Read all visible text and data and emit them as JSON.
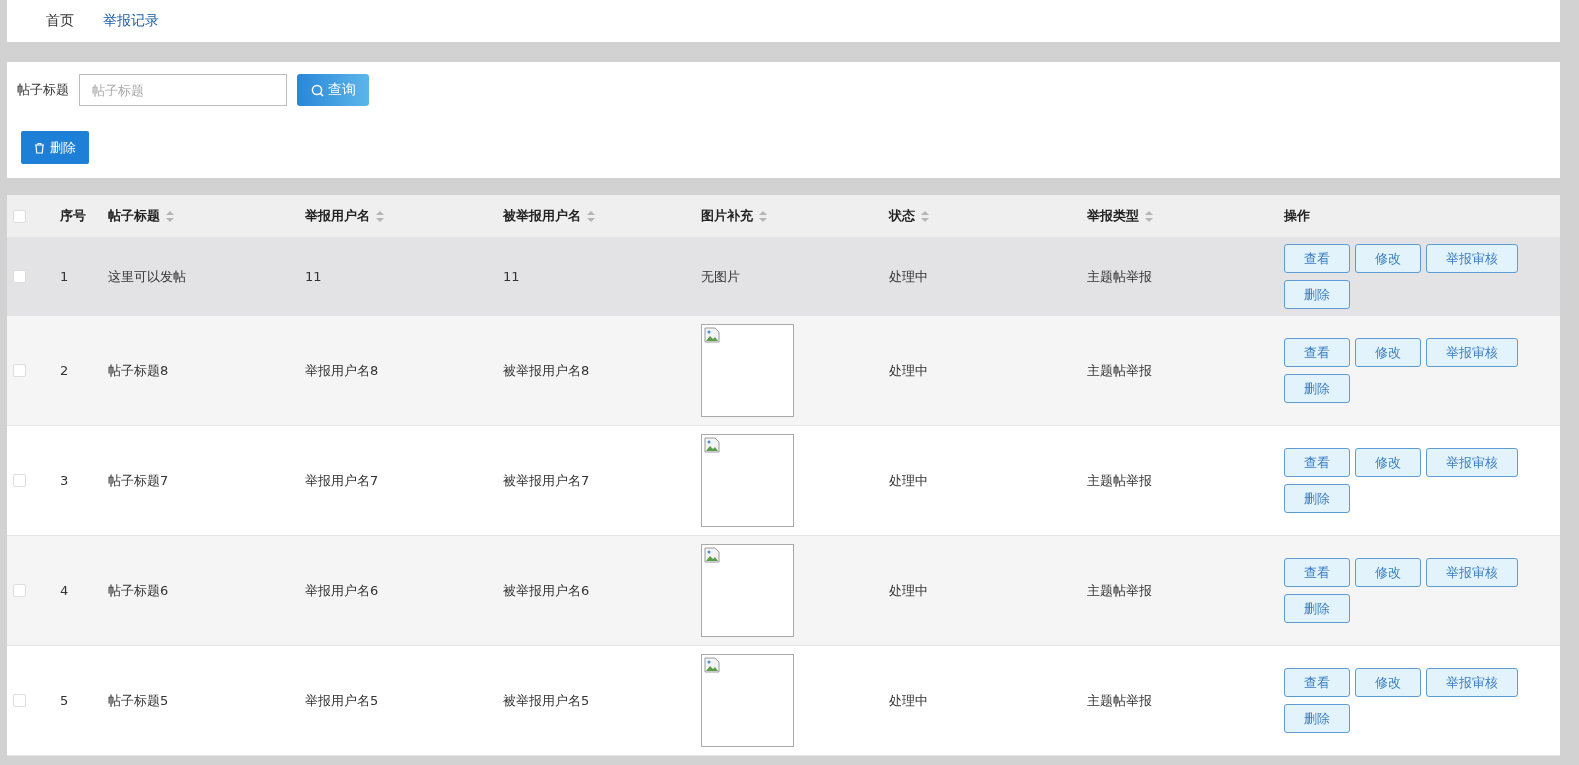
{
  "nav": [
    {
      "label": "首页",
      "selected": false
    },
    {
      "label": "举报记录",
      "selected": true
    }
  ],
  "search": {
    "label": "帖子标题",
    "placeholder": "帖子标题",
    "button": "查询"
  },
  "toolbar": {
    "delete_button": "删除"
  },
  "table": {
    "select_all": {
      "checked": false
    },
    "columns": [
      {
        "label": "序号",
        "sortable": false
      },
      {
        "label": "帖子标题",
        "sortable": true
      },
      {
        "label": "举报用户名",
        "sortable": true
      },
      {
        "label": "被举报用户名",
        "sortable": true
      },
      {
        "label": "图片补充",
        "sortable": true
      },
      {
        "label": "状态",
        "sortable": true
      },
      {
        "label": "举报类型",
        "sortable": true
      },
      {
        "label": "操作",
        "sortable": false
      }
    ],
    "rows": [
      {
        "checked": false,
        "hovered": true,
        "index": "1",
        "title": "这里可以发帖",
        "reporter": "11",
        "reported": "11",
        "image": {
          "kind": "text",
          "text": "无图片"
        },
        "status": "处理中",
        "type": "主题帖举报",
        "actions": [
          "查看",
          "修改",
          "举报审核",
          "删除"
        ]
      },
      {
        "checked": false,
        "hovered": false,
        "index": "2",
        "title": "帖子标题8",
        "reporter": "举报用户名8",
        "reported": "被举报用户名8",
        "image": {
          "kind": "broken"
        },
        "status": "处理中",
        "type": "主题帖举报",
        "actions": [
          "查看",
          "修改",
          "举报审核",
          "删除"
        ]
      },
      {
        "checked": false,
        "hovered": false,
        "index": "3",
        "title": "帖子标题7",
        "reporter": "举报用户名7",
        "reported": "被举报用户名7",
        "image": {
          "kind": "broken"
        },
        "status": "处理中",
        "type": "主题帖举报",
        "actions": [
          "查看",
          "修改",
          "举报审核",
          "删除"
        ]
      },
      {
        "checked": false,
        "hovered": false,
        "index": "4",
        "title": "帖子标题6",
        "reporter": "举报用户名6",
        "reported": "被举报用户名6",
        "image": {
          "kind": "broken"
        },
        "status": "处理中",
        "type": "主题帖举报",
        "actions": [
          "查看",
          "修改",
          "举报审核",
          "删除"
        ]
      },
      {
        "checked": false,
        "hovered": false,
        "index": "5",
        "title": "帖子标题5",
        "reporter": "举报用户名5",
        "reported": "被举报用户名5",
        "image": {
          "kind": "broken"
        },
        "status": "处理中",
        "type": "主题帖举报",
        "actions": [
          "查看",
          "修改",
          "举报审核",
          "删除"
        ]
      }
    ]
  }
}
